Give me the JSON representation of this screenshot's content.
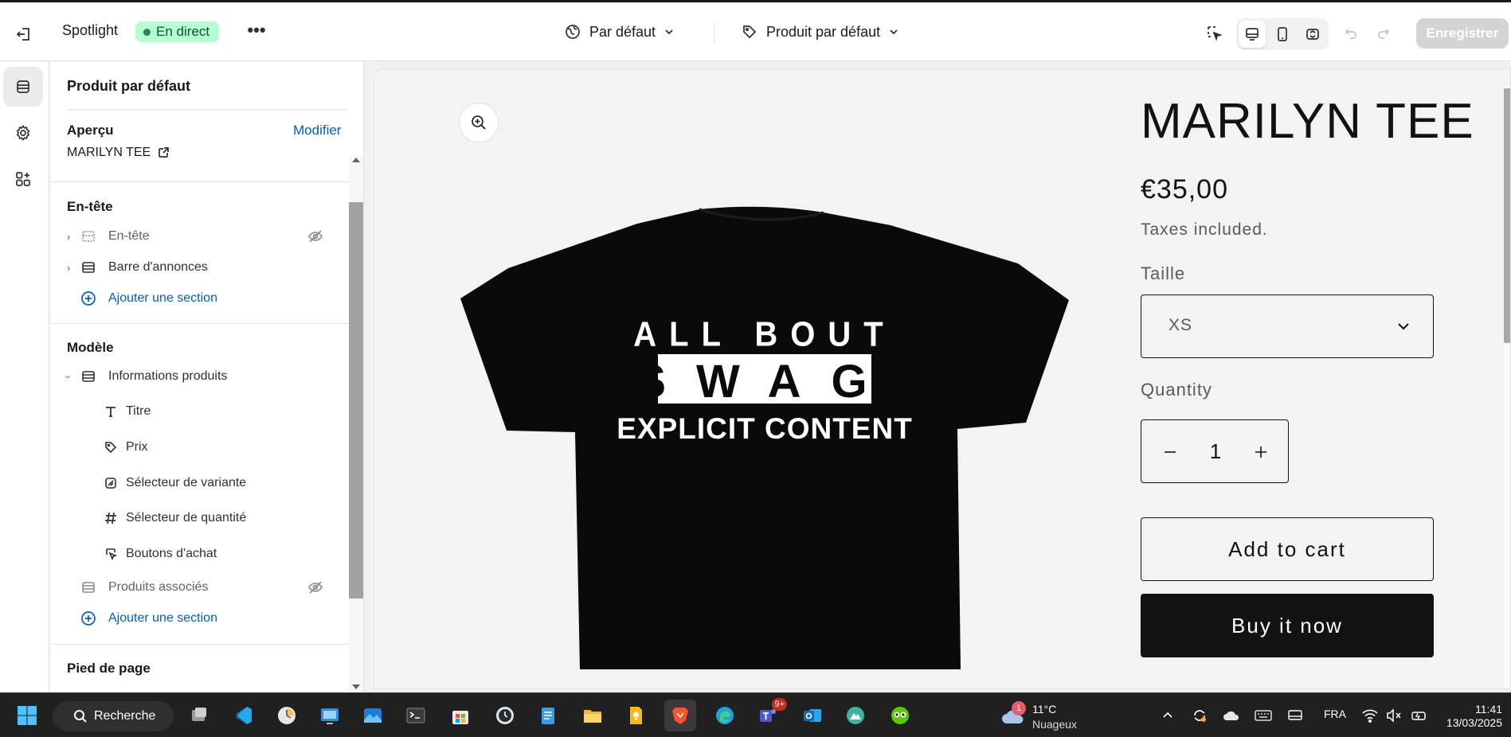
{
  "topbar": {
    "title": "Spotlight",
    "status": "En direct",
    "more": "•••",
    "view_dropdown": "Par défaut",
    "template_dropdown": "Produit par défaut",
    "save_label": "Enregistrer"
  },
  "panel": {
    "title": "Produit par défaut",
    "apercu_label": "Aperçu",
    "apercu_edit": "Modifier",
    "apercu_value": "MARILYN TEE",
    "header_section": {
      "title": "En-tête",
      "items": [
        {
          "label": "En-tête"
        },
        {
          "label": "Barre d'annonces"
        }
      ],
      "add_label": "Ajouter une section"
    },
    "template_section": {
      "title": "Modèle",
      "parent": "Informations produits",
      "blocks": [
        {
          "label": "Titre"
        },
        {
          "label": "Prix"
        },
        {
          "label": "Sélecteur de variante"
        },
        {
          "label": "Sélecteur de quantité"
        },
        {
          "label": "Boutons d'achat"
        }
      ],
      "related": "Produits associés",
      "add_label": "Ajouter une section"
    },
    "footer_section": {
      "title": "Pied de page"
    }
  },
  "product": {
    "title": "MARILYN TEE",
    "price": "€35,00",
    "tax_note": "Taxes included.",
    "size_label": "Taille",
    "size_value": "XS",
    "quantity_label": "Quantity",
    "quantity": "1",
    "add_to_cart": "Add to cart",
    "buy_now": "Buy it now",
    "tee_print": {
      "line1": "ALL BOUT",
      "line2": "SWAG",
      "line3": "EXPLICIT CONTENT"
    }
  },
  "taskbar": {
    "search_label": "Recherche",
    "teams_badge": "9+",
    "weather_badge": "1",
    "weather_temp": "11°C",
    "weather_desc": "Nuageux",
    "language": "FRA",
    "time": "11:41",
    "date": "13/03/2025"
  },
  "colors": {
    "accent_link": "#005bd3",
    "live_badge_bg": "#b4fed2",
    "live_badge_text": "#0c5132",
    "button_dark": "#121212"
  }
}
